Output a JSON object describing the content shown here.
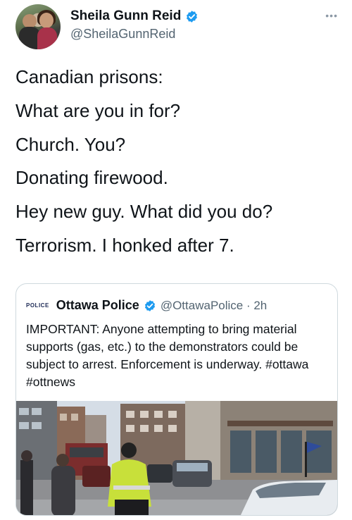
{
  "author": {
    "display_name": "Sheila Gunn Reid",
    "handle": "@SheilaGunnReid"
  },
  "tweet": {
    "lines": [
      "Canadian prisons:",
      "What are you in for?",
      "Church. You?",
      "Donating firewood.",
      "Hey new guy. What did you do?",
      "Terrorism. I honked after 7."
    ]
  },
  "quote": {
    "logo_text": "POLICE",
    "display_name": "Ottawa Police",
    "handle_time": "@OttawaPolice · 2h",
    "body": "IMPORTANT: Anyone attempting to bring material supports (gas, etc.) to the demonstrators could be subject to arrest. Enforcement is underway. #ottawa #ottnews"
  },
  "icons": {
    "verified": "verified-badge-icon",
    "more": "more-options-icon"
  },
  "colors": {
    "verified_blue": "#1d9bf0",
    "text_primary": "#0f1419",
    "text_secondary": "#536471",
    "border": "#cfd9de",
    "officer_vest": "#c8e03a"
  }
}
